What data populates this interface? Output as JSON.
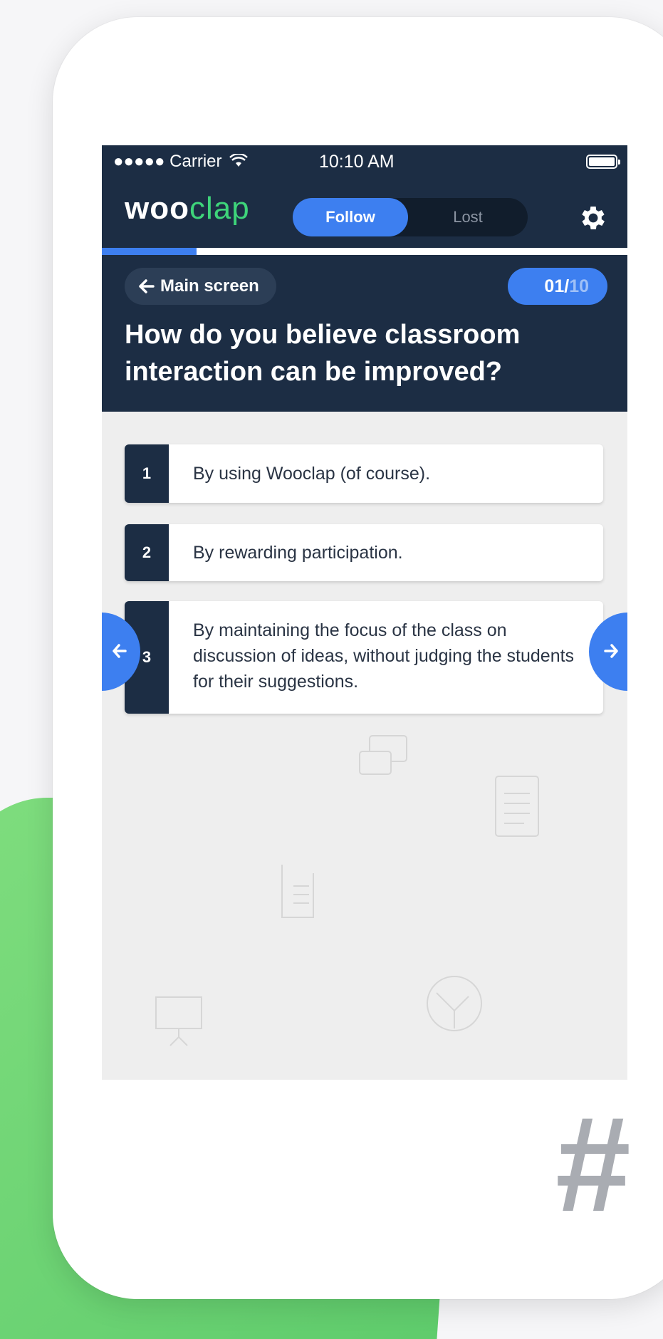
{
  "status_bar": {
    "carrier": "●●●●● Carrier",
    "wifi_icon": "wifi-icon",
    "time": "10:10 AM",
    "battery_icon": "battery-icon"
  },
  "nav": {
    "logo_bold": "woo",
    "logo_light": "clap",
    "toggle": {
      "follow_label": "Follow",
      "lost_label": "Lost",
      "selected": "Follow"
    },
    "settings_icon": "gear-icon"
  },
  "progress": {
    "fraction": 0.18
  },
  "question": {
    "back_label": "Main screen",
    "counter_current": "01/",
    "counter_total": "10",
    "text": "How do you believe classroom interaction can be improved?"
  },
  "answers": [
    {
      "number": "1",
      "text": "By using Wooclap (of course)."
    },
    {
      "number": "2",
      "text": "By rewarding participation."
    },
    {
      "number": "3",
      "text": "By maintaining the focus of the class on discussion of ideas, without judging the students for their suggestions."
    }
  ],
  "nav_arrows": {
    "prev_icon": "arrow-left-icon",
    "next_icon": "arrow-right-icon"
  },
  "decoration": {
    "hash_text": "#"
  },
  "colors": {
    "navy": "#1c2d44",
    "accent_blue": "#3d7ff0",
    "logo_green": "#3ed47a",
    "background_green": "#6dd676"
  }
}
